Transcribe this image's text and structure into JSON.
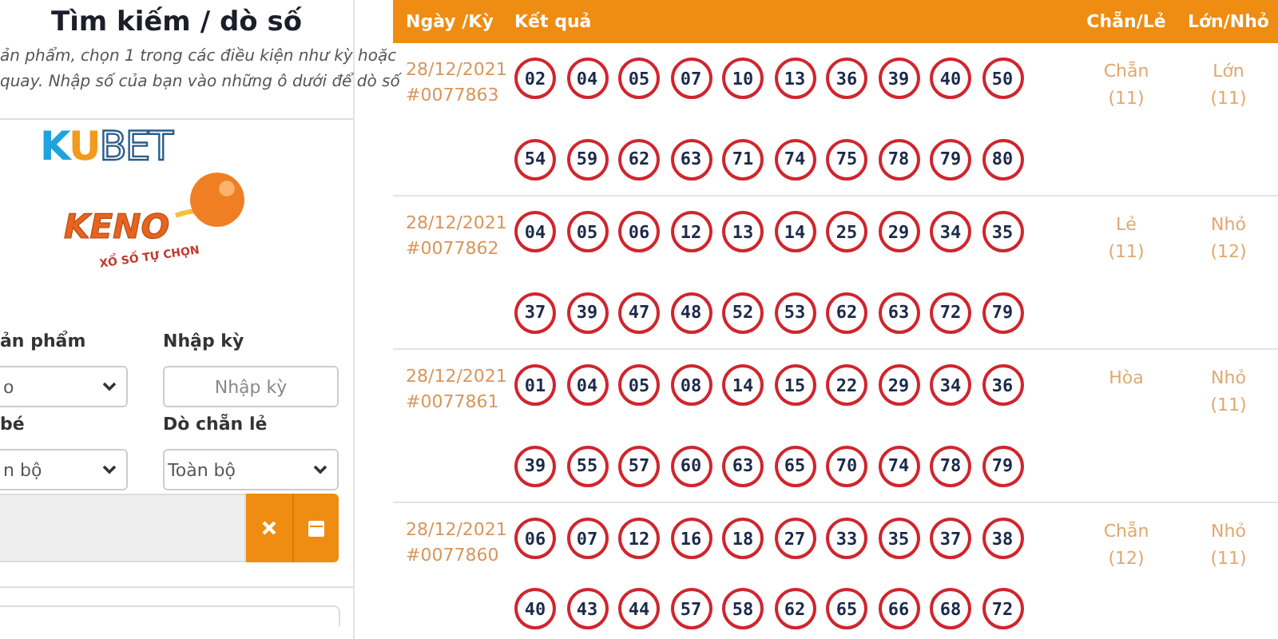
{
  "search_panel": {
    "title": "Tìm kiếm / dò số",
    "description": [
      "ản phẩm, chọn 1 trong các điều kiện như kỳ hoặc",
      "quay. Nhập số của bạn vào những ô dưới để dò số"
    ],
    "logo": {
      "brand": "KUBET",
      "product": "KENO",
      "tagline": "XỔ SỐ TỰ CHỌN"
    },
    "fields": [
      {
        "kind": "select",
        "label": "ản phẩm",
        "value": "o"
      },
      {
        "kind": "input",
        "label": "Nhập kỳ",
        "placeholder": "Nhập kỳ"
      },
      {
        "kind": "select",
        "label": "bé",
        "value": "n bộ"
      },
      {
        "kind": "select",
        "label": "Dò chẵn lẻ",
        "value": "Toàn bộ"
      }
    ]
  },
  "results_table": {
    "columns": [
      "Ngày /Kỳ",
      "Kết quả",
      "Chẵn/Lẻ",
      "Lớn/Nhỏ"
    ],
    "rows": [
      {
        "date": "28/12/2021",
        "draw": "#0077863",
        "numbers": [
          "02",
          "04",
          "05",
          "07",
          "10",
          "13",
          "36",
          "39",
          "40",
          "50",
          "54",
          "59",
          "62",
          "63",
          "71",
          "74",
          "75",
          "78",
          "79",
          "80"
        ],
        "even_odd": "Chẵn",
        "even_odd_count": "(11)",
        "big_small": "Lớn",
        "big_small_count": "(11)"
      },
      {
        "date": "28/12/2021",
        "draw": "#0077862",
        "numbers": [
          "04",
          "05",
          "06",
          "12",
          "13",
          "14",
          "25",
          "29",
          "34",
          "35",
          "37",
          "39",
          "47",
          "48",
          "52",
          "53",
          "62",
          "63",
          "72",
          "79"
        ],
        "even_odd": "Lẻ",
        "even_odd_count": "(11)",
        "big_small": "Nhỏ",
        "big_small_count": "(12)"
      },
      {
        "date": "28/12/2021",
        "draw": "#0077861",
        "numbers": [
          "01",
          "04",
          "05",
          "08",
          "14",
          "15",
          "22",
          "29",
          "34",
          "36",
          "39",
          "55",
          "57",
          "60",
          "63",
          "65",
          "70",
          "74",
          "78",
          "79"
        ],
        "even_odd": "Hòa",
        "big_small": "Nhỏ",
        "big_small_count": "(11)"
      },
      {
        "date": "28/12/2021",
        "draw": "#0077860",
        "numbers": [
          "06",
          "07",
          "12",
          "16",
          "18",
          "27",
          "33",
          "35",
          "37",
          "38",
          "40",
          "43",
          "44",
          "57",
          "58",
          "62",
          "65",
          "66",
          "68",
          "72"
        ],
        "even_odd": "Chẵn",
        "even_odd_count": "(12)",
        "big_small": "Nhỏ",
        "big_small_count": "(11)"
      }
    ]
  }
}
